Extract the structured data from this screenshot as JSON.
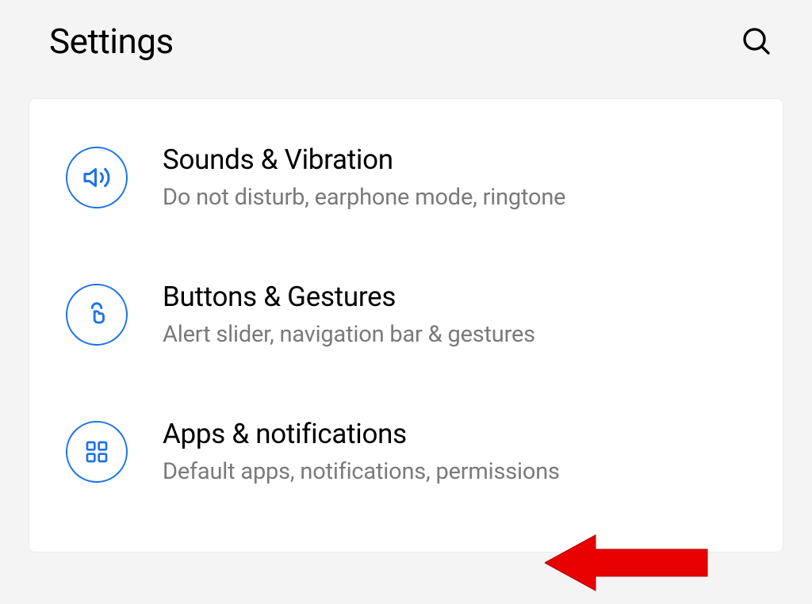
{
  "header": {
    "title": "Settings"
  },
  "items": [
    {
      "title": "Sounds & Vibration",
      "subtitle": "Do not disturb, earphone mode, ringtone"
    },
    {
      "title": "Buttons & Gestures",
      "subtitle": "Alert slider, navigation bar & gestures"
    },
    {
      "title": "Apps & notifications",
      "subtitle": "Default apps, notifications, permissions"
    }
  ]
}
